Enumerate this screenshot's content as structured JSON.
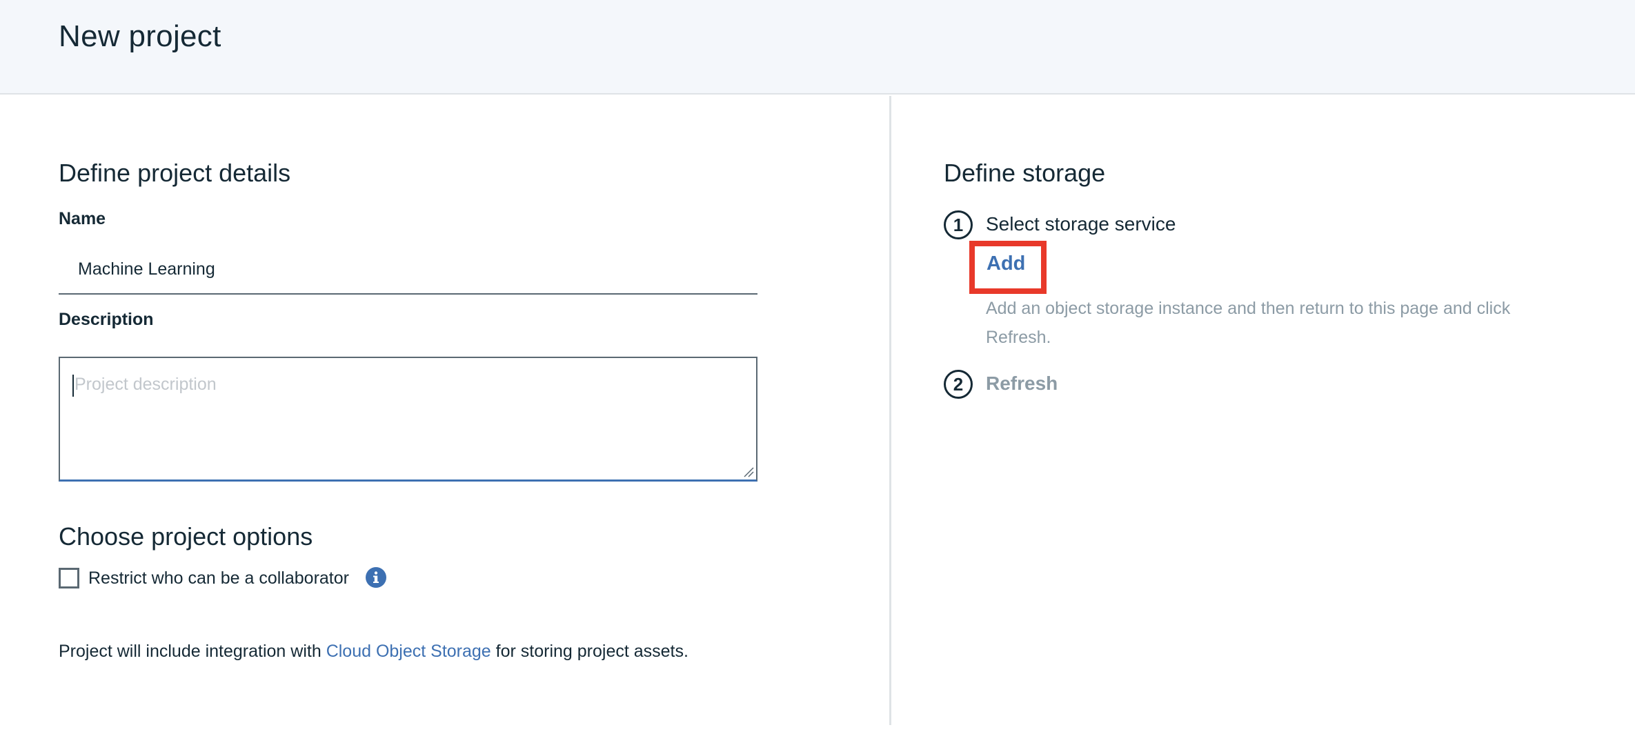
{
  "header": {
    "title": "New project"
  },
  "details": {
    "section_title": "Define project details",
    "name_label": "Name",
    "name_value": "Machine Learning",
    "description_label": "Description",
    "description_placeholder": "Project description"
  },
  "options": {
    "section_title": "Choose project options",
    "restrict_label": "Restrict who can be a collaborator",
    "restrict_checked": false,
    "integration_prefix": "Project will include integration with ",
    "integration_link": "Cloud Object Storage",
    "integration_suffix": " for storing project assets."
  },
  "storage": {
    "section_title": "Define storage",
    "step1_number": "1",
    "step1_label": "Select storage service",
    "add_label": "Add",
    "help_text": "Add an object storage instance and then return to this page and click Refresh.",
    "step2_number": "2",
    "step2_label": "Refresh"
  },
  "colors": {
    "accent": "#3d70b2",
    "highlight": "#e8392a",
    "header_bg": "#f4f7fb",
    "muted_text": "#8c9ba5"
  },
  "icons": {
    "info": "info-icon",
    "resize": "resize-handle-icon"
  }
}
